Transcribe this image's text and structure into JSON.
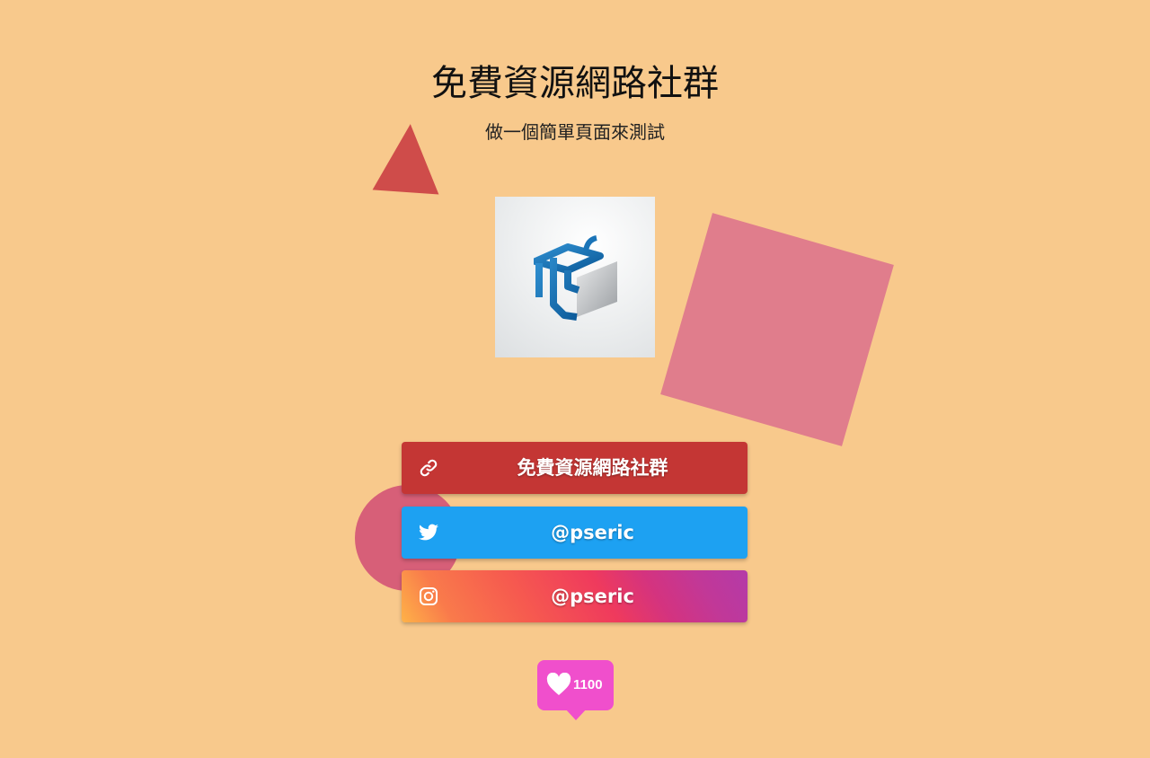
{
  "page": {
    "title": "免費資源網路社群",
    "subtitle": "做一個簡單頁面來測試",
    "background_color": "#f8c98c"
  },
  "avatar": {
    "icon": "cube-logo-icon"
  },
  "links": [
    {
      "label": "免費資源網路社群",
      "icon": "link-icon",
      "color": "#c43634"
    },
    {
      "label": "@pseric",
      "icon": "twitter-icon",
      "color": "#1da1f2"
    },
    {
      "label": "@pseric",
      "icon": "instagram-icon",
      "color": "gradient"
    }
  ],
  "like": {
    "icon": "heart-icon",
    "count": "1100",
    "color": "#f04fcc"
  },
  "decorations": {
    "triangle_color": "#cf4c4a",
    "square_color": "#e07d8c",
    "circle_color": "#d75f78"
  }
}
